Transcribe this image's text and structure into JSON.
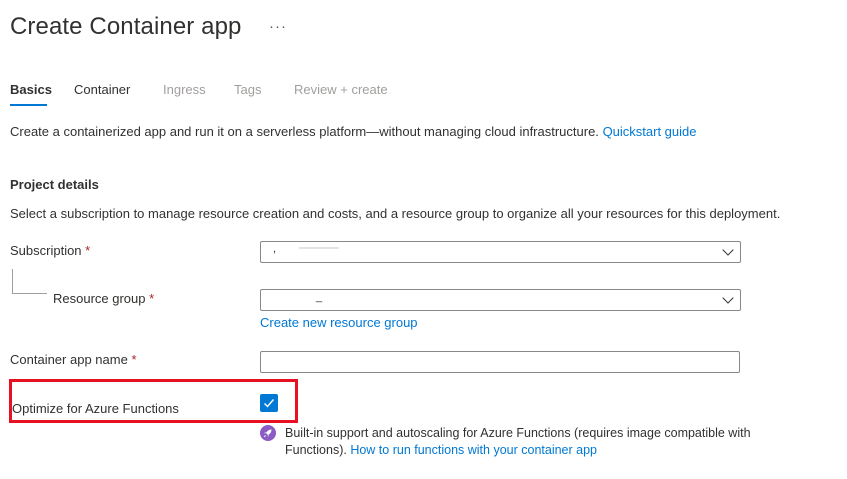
{
  "page": {
    "title": "Create Container app",
    "more_icon": "more-ellipsis-icon"
  },
  "tabs": [
    {
      "label": "Basics",
      "state": "active"
    },
    {
      "label": "Container",
      "state": "enabled"
    },
    {
      "label": "Ingress",
      "state": "disabled"
    },
    {
      "label": "Tags",
      "state": "disabled"
    },
    {
      "label": "Review + create",
      "state": "disabled"
    }
  ],
  "intro": {
    "text": "Create a containerized app and run it on a serverless platform—without managing cloud infrastructure.",
    "link": "Quickstart guide"
  },
  "project_details": {
    "title": "Project details",
    "description": "Select a subscription to manage resource creation and costs, and a resource group to organize all your resources for this deployment."
  },
  "form": {
    "subscription": {
      "label": "Subscription",
      "required_mark": "*",
      "value": ","
    },
    "resource_group": {
      "label": "Resource group",
      "required_mark": "*",
      "value": "_",
      "create_link": "Create new resource group"
    },
    "container_app_name": {
      "label": "Container app name",
      "required_mark": "*",
      "value": ""
    },
    "optimize_functions": {
      "label": "Optimize for Azure Functions",
      "checked": true
    }
  },
  "functions_info": {
    "text": "Built-in support and autoscaling for Azure Functions (requires image compatible with Functions).",
    "link": "How to run functions with your container app",
    "icon": "rocket-icon"
  },
  "colors": {
    "accent": "#0078d4",
    "highlight": "#e81123",
    "required": "#a4262c",
    "info_icon": "#8b5cc4"
  }
}
